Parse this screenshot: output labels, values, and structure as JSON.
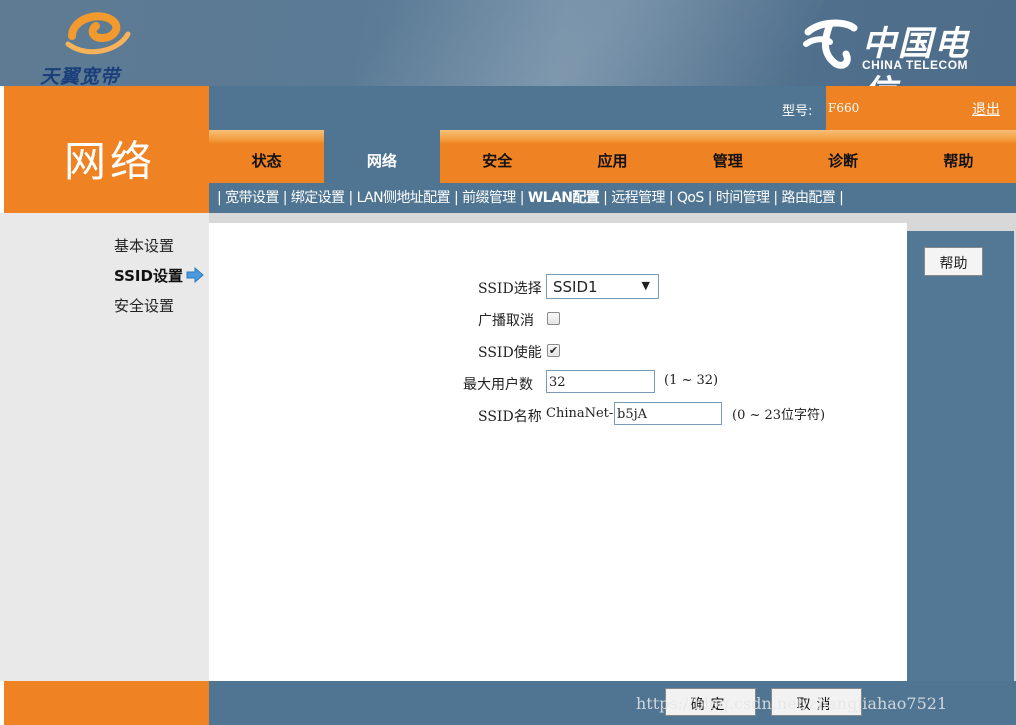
{
  "header": {
    "brand_left": "天翼宽带",
    "brand_right_cn": "中国电信",
    "brand_right_en": "CHINA TELECOM"
  },
  "section_title": "网络",
  "topbar": {
    "model_label": "型号:",
    "model_value": "F660",
    "logout_label": "退出"
  },
  "tabs": [
    {
      "label": "状态"
    },
    {
      "label": "网络"
    },
    {
      "label": "安全"
    },
    {
      "label": "应用"
    },
    {
      "label": "管理"
    },
    {
      "label": "诊断"
    },
    {
      "label": "帮助"
    }
  ],
  "subnav": [
    {
      "label": "宽带设置"
    },
    {
      "label": "绑定设置"
    },
    {
      "label": "LAN侧地址配置"
    },
    {
      "label": "前缀管理"
    },
    {
      "label": "WLAN配置"
    },
    {
      "label": "远程管理"
    },
    {
      "label": "QoS"
    },
    {
      "label": "时间管理"
    },
    {
      "label": "路由配置"
    }
  ],
  "sidemenu": [
    {
      "label": "基本设置"
    },
    {
      "label": "SSID设置"
    },
    {
      "label": "安全设置"
    }
  ],
  "form": {
    "ssid_select_label": "SSID选择",
    "ssid_select_value": "SSID1",
    "broadcast_cancel_label": "广播取消",
    "broadcast_cancel_checked": false,
    "ssid_enable_label": "SSID使能",
    "ssid_enable_checked": true,
    "max_users_label": "最大用户数",
    "max_users_value": "32",
    "max_users_hint": "(1 ~ 32)",
    "ssid_name_label": "SSID名称",
    "ssid_name_prefix": "ChinaNet-",
    "ssid_name_value": "b5jA",
    "ssid_name_hint": "(0 ~ 23位字符)"
  },
  "right_panel": {
    "help_label": "帮助"
  },
  "footer": {
    "confirm_label": "确定",
    "cancel_label": "取消",
    "watermark": "https://blog.csdn.net/zhangjiahao7521"
  },
  "colors": {
    "accent_orange": "#ef8222",
    "steel_blue": "#4f7592",
    "logo_blue": "#1a3f7a"
  }
}
